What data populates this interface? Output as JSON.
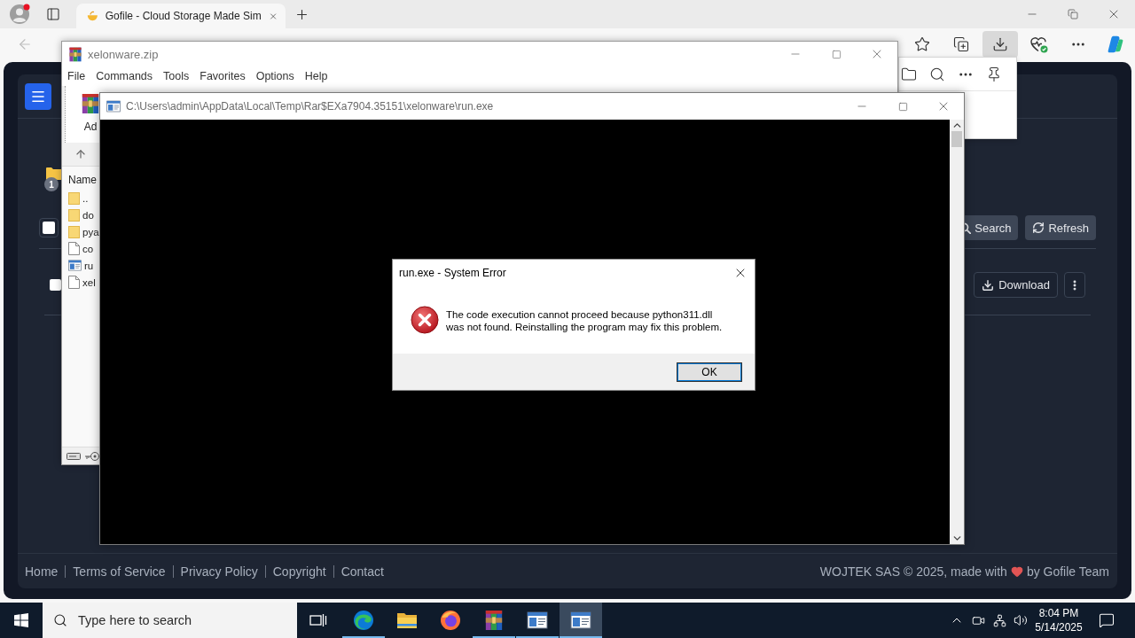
{
  "browser": {
    "tabs": [
      {
        "title": "Gofile - Cloud Storage Made Sim",
        "selected": true
      }
    ],
    "back_button": {
      "disabled": true
    },
    "downloads_button": {
      "selected": true
    }
  },
  "gofile": {
    "folder_badge": "1",
    "select_all": {
      "checked": false
    },
    "search_button": "Search",
    "refresh_button": "Refresh",
    "files": [
      {
        "checked": false,
        "download_button": "Download"
      }
    ],
    "footer": {
      "links": [
        "Home",
        "Terms of Service",
        "Privacy Policy",
        "Copyright",
        "Contact"
      ],
      "credit_before": "WOJTEK SAS © 2025, made with",
      "credit_after": "by Gofile Team"
    }
  },
  "winrar": {
    "title": "xelonware.zip",
    "menu": [
      "File",
      "Commands",
      "Tools",
      "Favorites",
      "Options",
      "Help"
    ],
    "toolbar_label": "Ad",
    "column": "Name",
    "files": [
      {
        "name": "..",
        "kind": "folder"
      },
      {
        "name": "do",
        "kind": "folder"
      },
      {
        "name": "pya",
        "kind": "folder"
      },
      {
        "name": "co",
        "kind": "file"
      },
      {
        "name": "ru",
        "kind": "exe"
      },
      {
        "name": "xel",
        "kind": "file"
      }
    ]
  },
  "console": {
    "title": "C:\\Users\\admin\\AppData\\Local\\Temp\\Rar$EXa7904.35151\\xelonware\\run.exe"
  },
  "error_dialog": {
    "title": "run.exe - System Error",
    "message": "The code execution cannot proceed because python311.dll\nwas not found. Reinstalling the program may fix this problem.",
    "button": "OK"
  },
  "taskbar": {
    "search_placeholder": "Type here to search",
    "apps": [
      {
        "kind": "edge",
        "running": true,
        "selected": false
      },
      {
        "kind": "explorer",
        "running": false,
        "selected": false
      },
      {
        "kind": "firefox",
        "running": false,
        "selected": false
      },
      {
        "kind": "winrar",
        "running": true,
        "selected": false
      },
      {
        "kind": "console",
        "running": true,
        "selected": false
      },
      {
        "kind": "console",
        "running": true,
        "selected": true
      }
    ],
    "time": "8:04 PM",
    "date": "5/14/2025"
  }
}
